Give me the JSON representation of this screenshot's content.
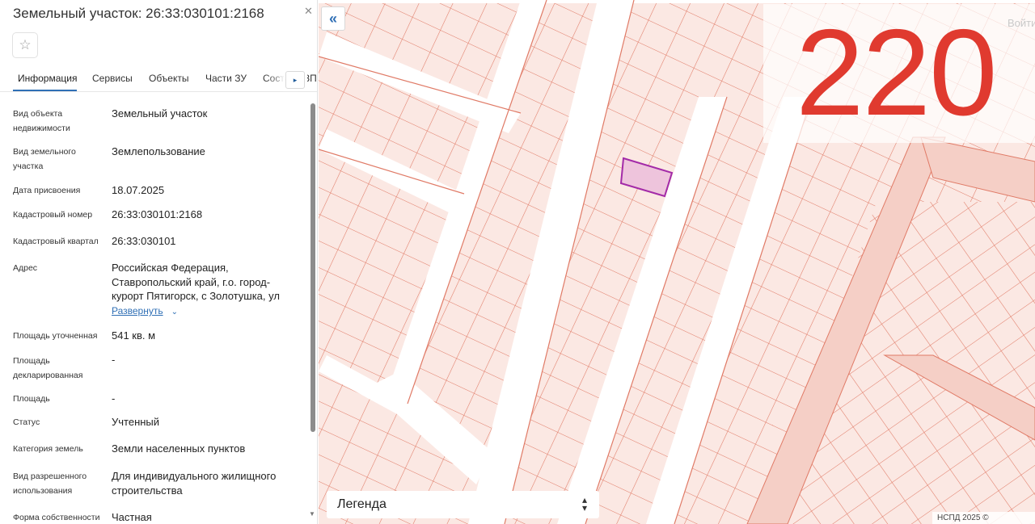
{
  "panel": {
    "title": "Земельный участок: 26:33:030101:2168",
    "close": "✕",
    "star": "☆",
    "tabs": [
      "Информация",
      "Сервисы",
      "Объекты",
      "Части ЗУ",
      "Состав ЕЗП"
    ],
    "tabs_next": "▸",
    "expand_label": "Развернуть",
    "expand_chevron": "⌄",
    "fields": [
      {
        "label": "Вид объекта недвижимости",
        "value": "Земельный участок"
      },
      {
        "label": "Вид земельного участка",
        "value": "Землепользование"
      },
      {
        "label": "Дата присвоения",
        "value": "18.07.2025"
      },
      {
        "label": "Кадастровый номер",
        "value": "26:33:030101:2168"
      },
      {
        "label": "Кадастровый квартал",
        "value": "26:33:030101"
      },
      {
        "label": "Адрес",
        "value": "Российская Федерация, Ставропольский край, г.о. город-курорт Пятигорск, с Золотушка, ул"
      },
      {
        "label": "Площадь уточненная",
        "value": "541 кв. м"
      },
      {
        "label": "Площадь декларированная",
        "value": "-"
      },
      {
        "label": "Площадь",
        "value": "-"
      },
      {
        "label": "Статус",
        "value": "Учтенный"
      },
      {
        "label": "Категория земель",
        "value": "Земли населенных пунктов"
      },
      {
        "label": "Вид разрешенного использования",
        "value": "Для индивидуального жилищного строительства"
      },
      {
        "label": "Форма собственности",
        "value": "Частная"
      }
    ]
  },
  "map": {
    "collapse": "«",
    "overlay_number": "220",
    "login": "Войти",
    "legend": "Легенда",
    "legend_toggle_up": "▴",
    "legend_toggle_down": "▾",
    "copyright": "НСПД 2025 ©",
    "colors": {
      "parcel_fill": "#fbe8e3",
      "parcel_stroke": "#e07a66",
      "road": "#ffffff",
      "selected_fill": "#eec4dc",
      "selected_stroke": "#a32aa8",
      "overlay_number": "#e03a2f",
      "accent": "#2f6fb5"
    }
  }
}
